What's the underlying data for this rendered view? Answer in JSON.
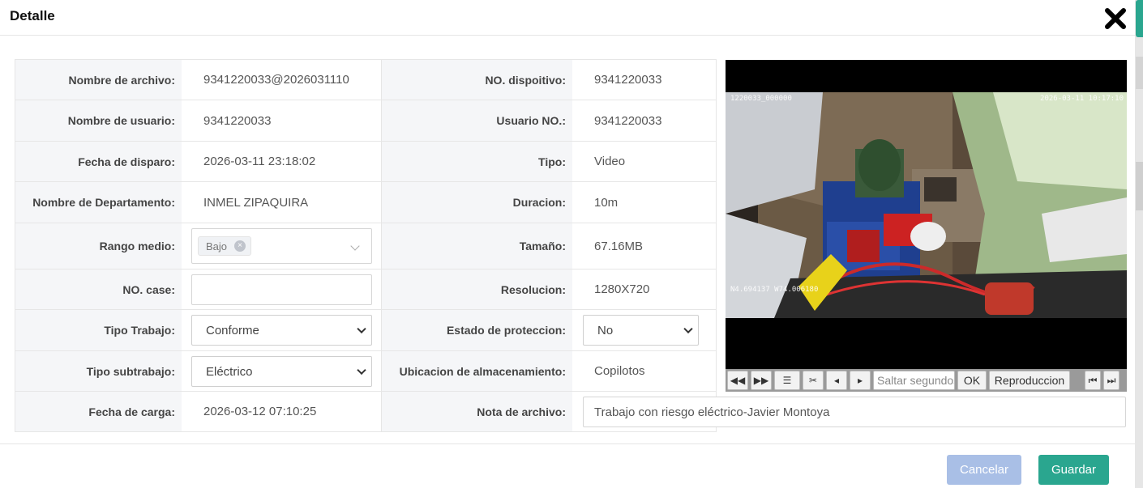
{
  "modal": {
    "title": "Detalle",
    "close_icon": "close-icon"
  },
  "fields": {
    "nombre_archivo": {
      "label": "Nombre de archivo:",
      "value": "9341220033@2026031110"
    },
    "no_dispositivo": {
      "label": "NO. dispoitivo:",
      "value": "9341220033"
    },
    "nombre_usuario": {
      "label": "Nombre de usuario:",
      "value": "9341220033"
    },
    "usuario_no": {
      "label": "Usuario NO.:",
      "value": "9341220033"
    },
    "fecha_disparo": {
      "label": "Fecha de disparo:",
      "value": "2026-03-11 23:18:02"
    },
    "tipo": {
      "label": "Tipo:",
      "value": "Video"
    },
    "departamento": {
      "label": "Nombre de Departamento:",
      "value": "INMEL ZIPAQUIRA"
    },
    "duracion": {
      "label": "Duracion:",
      "value": "10m"
    },
    "rango_medio": {
      "label": "Rango medio:",
      "tag": "Bajo"
    },
    "tamano": {
      "label": "Tamaño:",
      "value": "67.16MB"
    },
    "no_case": {
      "label": "NO. case:",
      "value": ""
    },
    "resolucion": {
      "label": "Resolucion:",
      "value": "1280X720"
    },
    "tipo_trabajo": {
      "label": "Tipo Trabajo:",
      "value": "Conforme"
    },
    "estado_proteccion": {
      "label": "Estado de proteccion:",
      "value": "No"
    },
    "tipo_subtrabajo": {
      "label": "Tipo subtrabajo:",
      "value": "Eléctrico"
    },
    "ubicacion": {
      "label": "Ubicacion de almacenamiento:",
      "value": "Copilotos"
    },
    "fecha_carga": {
      "label": "Fecha de carga:",
      "value": "2026-03-12 07:10:25"
    },
    "nota_archivo": {
      "label": "Nota de archivo:",
      "value": "Trabajo con riesgo eléctrico-Javier Montoya"
    }
  },
  "video": {
    "overlay_top_left": "1220033_000000",
    "overlay_top_right": "2026-03-11 10:17:10",
    "overlay_bottom_left": "N4.694137  W74.006180",
    "controls": {
      "seek_placeholder": "Saltar segundos",
      "ok_label": "OK",
      "playback_label": "Reproduccion"
    }
  },
  "footer": {
    "cancel_label": "Cancelar",
    "save_label": "Guardar"
  },
  "colors": {
    "primary": "#2aa68f",
    "cancel": "#a9bfe6"
  }
}
